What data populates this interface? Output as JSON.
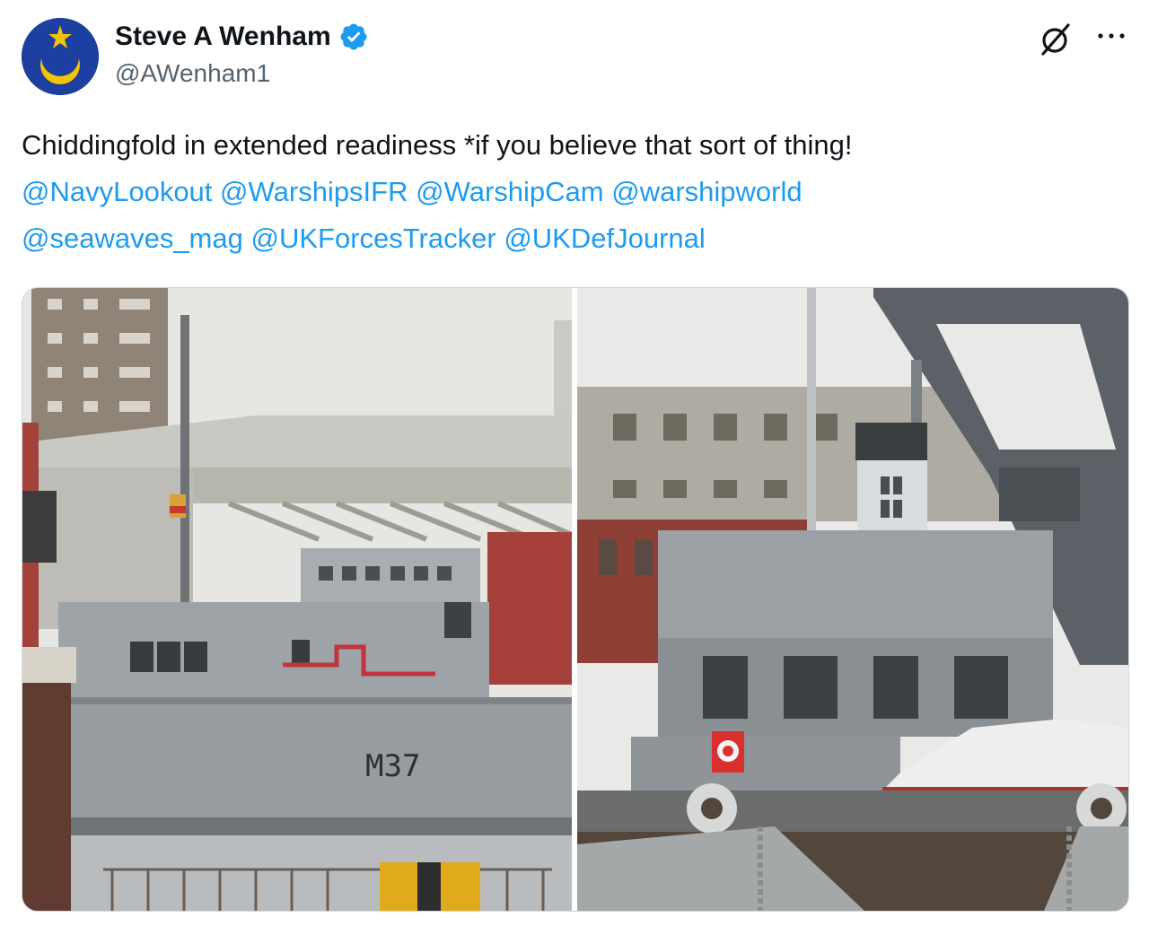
{
  "author": {
    "display_name": "Steve A Wenham",
    "handle": "@AWenham1",
    "verified": true
  },
  "icons": {
    "verified": "verified-badge-icon",
    "grok": "grok-icon",
    "more": "more-options-icon"
  },
  "tweet": {
    "text": "Chiddingfold in extended readiness *if you believe that sort of thing!",
    "mentions": [
      "@NavyLookout",
      "@WarshipsIFR",
      "@WarshipCam",
      "@warshipworld",
      "@seawaves_mag",
      "@UKForcesTracker",
      "@UKDefJournal"
    ]
  },
  "media": {
    "photo_left": {
      "hull_number": "M37"
    },
    "photo_right": {}
  },
  "colors": {
    "link": "#1d9bf0",
    "text": "#0f1419",
    "secondary": "#536471",
    "verified": "#1d9bf0"
  }
}
